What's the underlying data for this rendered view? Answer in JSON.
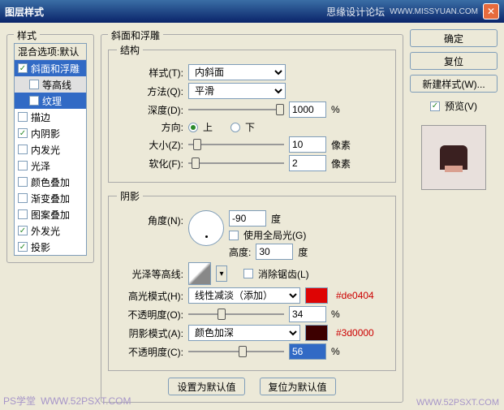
{
  "titlebar": {
    "title": "图层样式",
    "forum": "思缘设计论坛",
    "url": "WWW.MISSYUAN.COM"
  },
  "styles": {
    "panel": "样式",
    "blend": "混合选项:默认",
    "items": [
      {
        "label": "斜面和浮雕",
        "checked": true,
        "selected": true
      },
      {
        "label": "等高线",
        "checked": false,
        "sub": true
      },
      {
        "label": "纹理",
        "checked": false,
        "sub": true,
        "selected": true
      },
      {
        "label": "描边",
        "checked": false
      },
      {
        "label": "内阴影",
        "checked": true
      },
      {
        "label": "内发光",
        "checked": false
      },
      {
        "label": "光泽",
        "checked": false
      },
      {
        "label": "颜色叠加",
        "checked": false
      },
      {
        "label": "渐变叠加",
        "checked": false
      },
      {
        "label": "图案叠加",
        "checked": false
      },
      {
        "label": "外发光",
        "checked": true
      },
      {
        "label": "投影",
        "checked": true
      }
    ]
  },
  "bevel": {
    "panel": "斜面和浮雕",
    "struct": "结构",
    "style_l": "样式(T):",
    "style_v": "内斜面",
    "tech_l": "方法(Q):",
    "tech_v": "平滑",
    "depth_l": "深度(D):",
    "depth_v": "1000",
    "pct": "%",
    "dir_l": "方向:",
    "up": "上",
    "down": "下",
    "size_l": "大小(Z):",
    "size_v": "10",
    "px": "像素",
    "soft_l": "软化(F):",
    "soft_v": "2",
    "shade": "阴影",
    "angle_l": "角度(N):",
    "angle_v": "-90",
    "deg": "度",
    "global": "使用全局光(G)",
    "alt_l": "高度:",
    "alt_v": "30",
    "gloss_l": "光泽等高线:",
    "aa": "消除锯齿(L)",
    "hi_l": "高光模式(H):",
    "hi_v": "线性减淡（添加）",
    "hi_hex": "#de0404",
    "hi_color": "#de0404",
    "hiop_l": "不透明度(O):",
    "hiop_v": "34",
    "sh_l": "阴影模式(A):",
    "sh_v": "颜色加深",
    "sh_hex": "#3d0000",
    "sh_color": "#3d0000",
    "shop_l": "不透明度(C):",
    "shop_v": "56",
    "def1": "设置为默认值",
    "def2": "复位为默认值"
  },
  "right": {
    "ok": "确定",
    "cancel": "复位",
    "new": "新建样式(W)...",
    "preview": "预览(V)"
  },
  "wm": {
    "a": "PS学堂",
    "b": "WWW.52PSXT.COM",
    "c": "WWW.52PSXT.COM"
  }
}
